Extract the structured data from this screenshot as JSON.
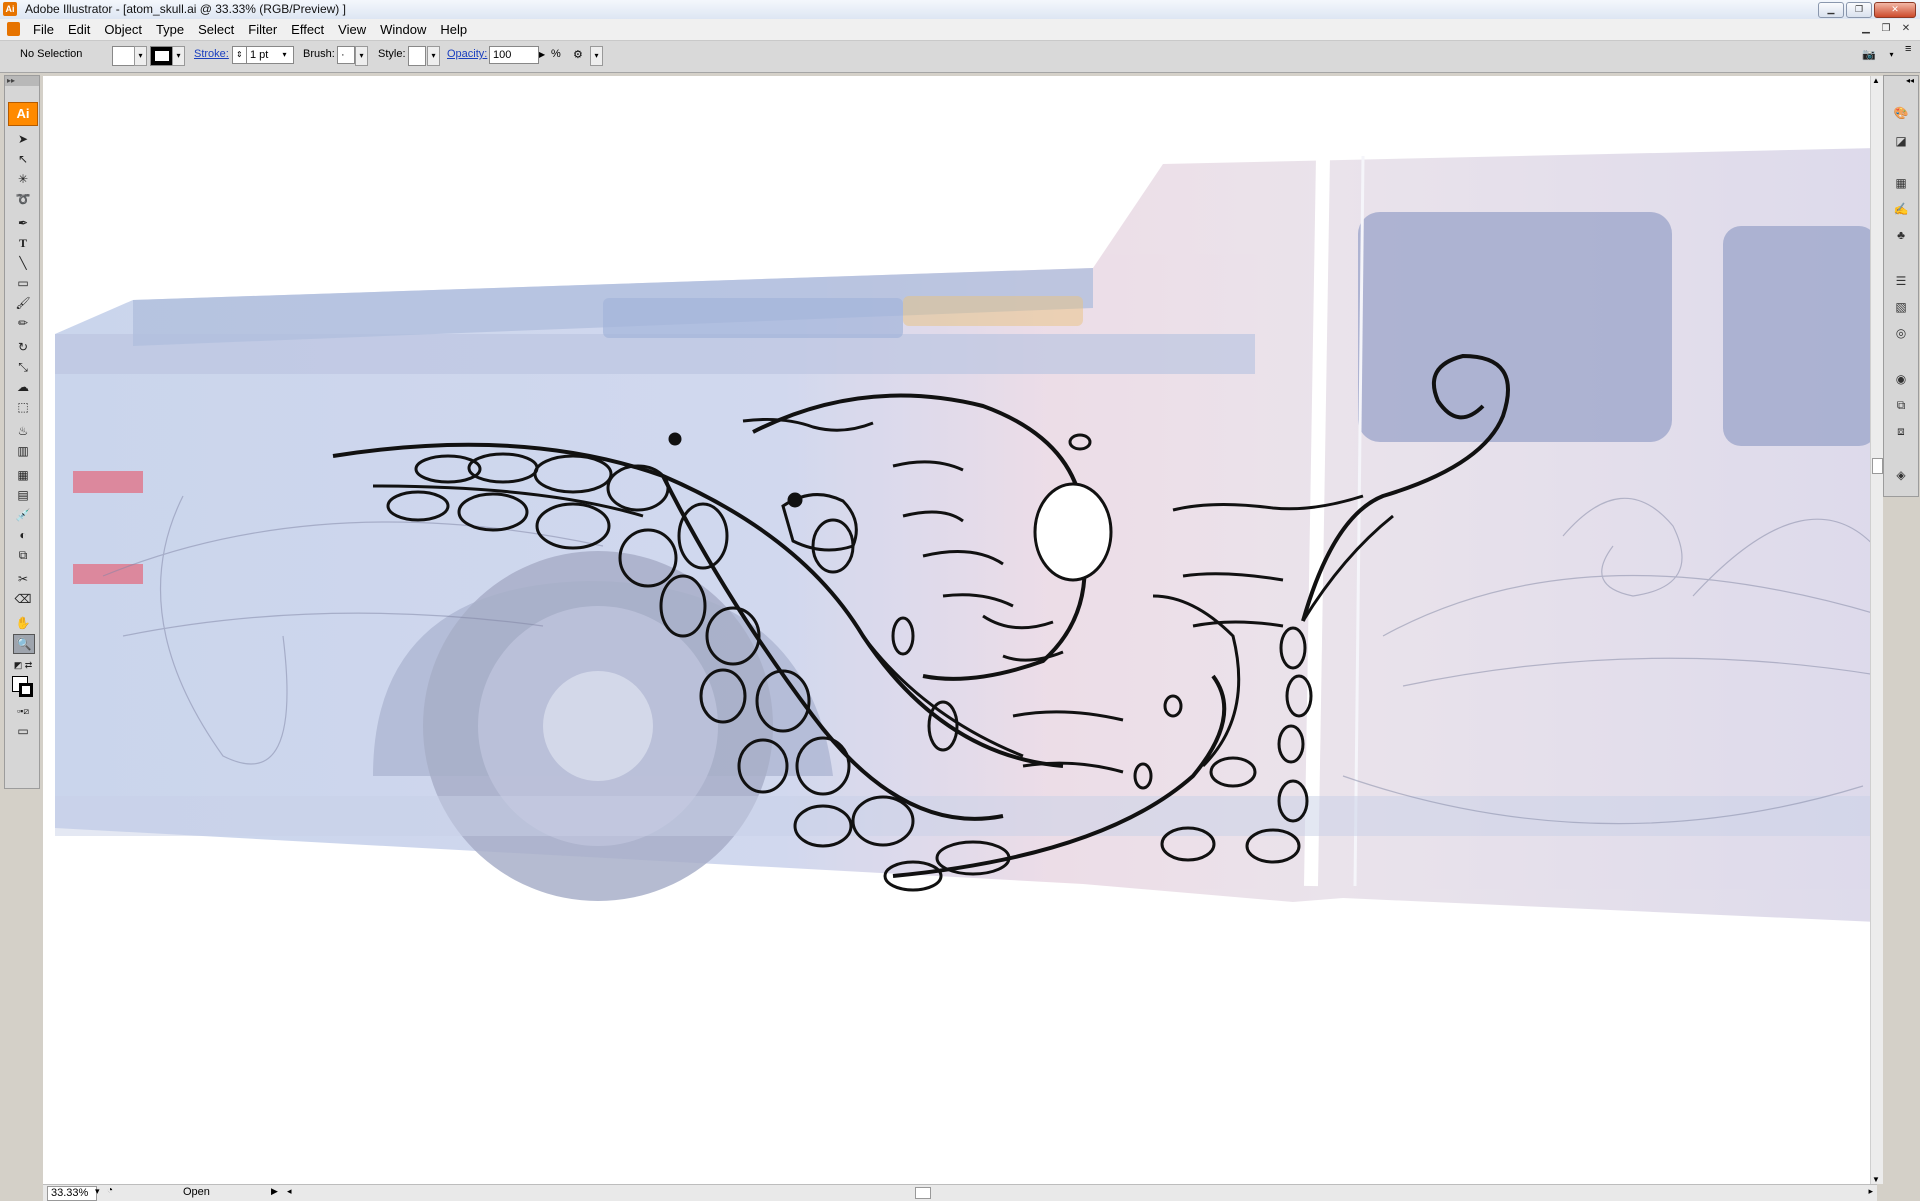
{
  "window": {
    "title": "Adobe Illustrator - [atom_skull.ai @ 33.33% (RGB/Preview) ]",
    "app_badge": "Ai"
  },
  "menubar": {
    "items": [
      "File",
      "Edit",
      "Object",
      "Type",
      "Select",
      "Filter",
      "Effect",
      "View",
      "Window",
      "Help"
    ]
  },
  "control_bar": {
    "selection": "No Selection",
    "stroke_label": "Stroke:",
    "stroke_value": "1 pt",
    "brush_label": "Brush:",
    "brush_value": "·",
    "style_label": "Style:",
    "opacity_label": "Opacity:",
    "opacity_value": "100",
    "opacity_unit": "%"
  },
  "tools": {
    "logo": "Ai",
    "items": [
      "selection-tool",
      "direct-selection-tool",
      "magic-wand-tool",
      "lasso-tool",
      "pen-tool",
      "type-tool",
      "line-tool",
      "rectangle-tool",
      "paintbrush-tool",
      "pencil-tool",
      "rotate-tool",
      "scale-tool",
      "warp-tool",
      "free-transform-tool",
      "symbol-sprayer-tool",
      "column-graph-tool",
      "mesh-tool",
      "gradient-tool",
      "eyedropper-tool",
      "blend-tool",
      "live-paint-tool",
      "slice-tool",
      "eraser-tool",
      "hand-tool",
      "zoom-tool"
    ],
    "selected": "zoom-tool"
  },
  "status_bar": {
    "zoom": "33.33%",
    "status": "Open"
  }
}
